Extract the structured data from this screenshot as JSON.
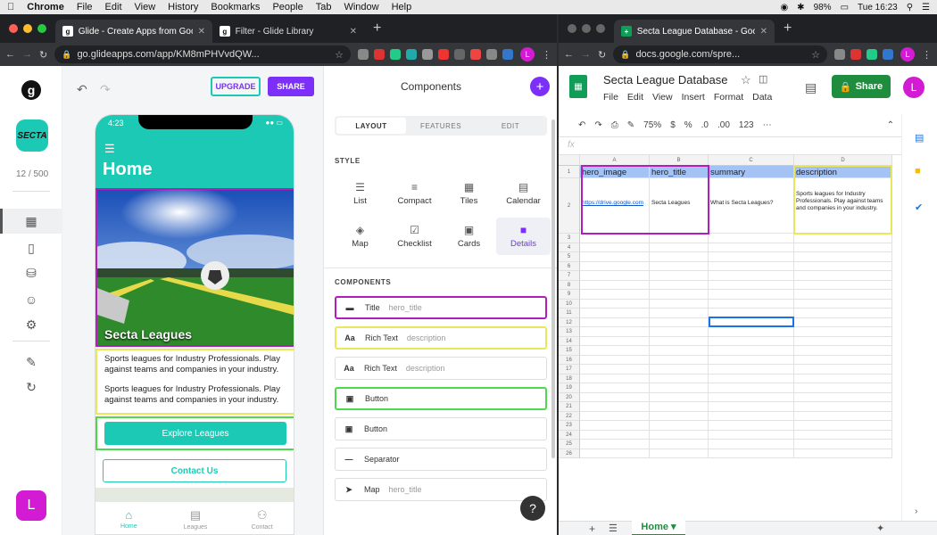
{
  "menubar": {
    "app": "Chrome",
    "items": [
      "File",
      "Edit",
      "View",
      "History",
      "Bookmarks",
      "People",
      "Tab",
      "Window",
      "Help"
    ],
    "battery": "98%",
    "clock": "Tue 16:23"
  },
  "left_browser": {
    "tabs": [
      {
        "title": "Glide - Create Apps from Google",
        "favicon": "g",
        "active": true
      },
      {
        "title": "Filter - Glide Library",
        "favicon": "g",
        "active": false
      }
    ],
    "url": "go.glideapps.com/app/KM8mPHVvdQW...",
    "profile_letter": "L"
  },
  "glide": {
    "app_logo_text": "SECTA",
    "row_count": "12 / 500",
    "user_letter": "L",
    "upgrade_label": "UPGRADE",
    "share_label": "SHARE",
    "phone": {
      "time": "4:23",
      "page_title": "Home",
      "hero_title": "Secta Leagues",
      "rich_text_1": "Sports leagues for Industry Professionals. Play against teams and companies in your industry.",
      "rich_text_2": "Sports leagues for Industry Professionals. Play against teams and companies in your industry.",
      "button_primary": "Explore Leagues",
      "button_secondary": "Contact Us",
      "tabbar": [
        "Home",
        "Leagues",
        "Contact"
      ]
    },
    "panel": {
      "title": "Components",
      "segments": [
        "LAYOUT",
        "FEATURES",
        "EDIT"
      ],
      "style_label": "STYLE",
      "styles": [
        "List",
        "Compact",
        "Tiles",
        "Calendar",
        "Map",
        "Checklist",
        "Cards",
        "Details"
      ],
      "components_label": "COMPONENTS",
      "components": [
        {
          "name": "Title",
          "source": "hero_title"
        },
        {
          "name": "Rich Text",
          "source": "description"
        },
        {
          "name": "Rich Text",
          "source": "description"
        },
        {
          "name": "Button",
          "source": ""
        },
        {
          "name": "Button",
          "source": ""
        },
        {
          "name": "Separator",
          "source": ""
        },
        {
          "name": "Map",
          "source": "hero_title"
        }
      ],
      "help": "?"
    }
  },
  "right_browser": {
    "tab_title": "Secta League Database - Googl",
    "url": "docs.google.com/spre...",
    "profile_letter": "L"
  },
  "sheets": {
    "title": "Secta League Database",
    "menu": [
      "File",
      "Edit",
      "View",
      "Insert",
      "Format",
      "Data"
    ],
    "share_label": "Share",
    "zoom": "75%",
    "fx": "fx",
    "columns": [
      "A",
      "B",
      "C",
      "D"
    ],
    "header_row": [
      "hero_image",
      "hero_title",
      "summary",
      "description"
    ],
    "data_row": [
      "https://drive.google.com",
      "Secta Leagues",
      "What is Secta Leagues?",
      "Sports leagues for Industry Professionals. Play against teams and companies in your industry."
    ],
    "row_numbers": [
      "1",
      "2",
      "3",
      "4",
      "5",
      "6",
      "7",
      "8",
      "9",
      "10",
      "11",
      "12",
      "13",
      "14",
      "15",
      "16",
      "17",
      "18",
      "19",
      "20",
      "21",
      "22",
      "23",
      "24",
      "25",
      "26"
    ],
    "sheet_tab": "Home"
  }
}
